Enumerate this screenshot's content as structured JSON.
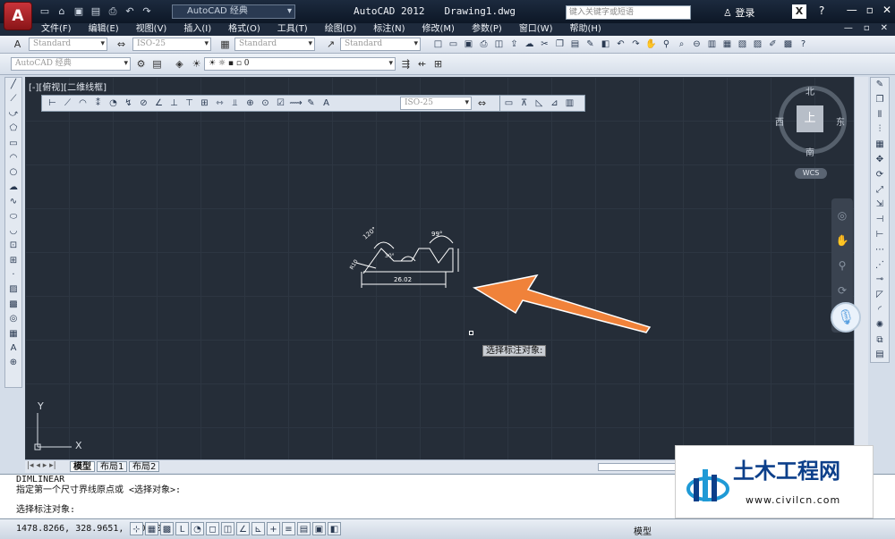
{
  "title": {
    "app": "AutoCAD 2012",
    "file": "Drawing1.dwg",
    "app_letter": "A"
  },
  "workspace": "AutoCAD 经典",
  "search": {
    "placeholder": "键入关键字或短语"
  },
  "login_label": "登录",
  "menu": [
    "文件(F)",
    "编辑(E)",
    "视图(V)",
    "插入(I)",
    "格式(O)",
    "工具(T)",
    "绘图(D)",
    "标注(N)",
    "修改(M)",
    "参数(P)",
    "窗口(W)",
    "帮助(H)"
  ],
  "styles": {
    "text_style": "Standard",
    "dim_style": "ISO-25",
    "table_style": "Standard",
    "multileader_style": "Standard"
  },
  "layer": {
    "workspace2": "AutoCAD 经典",
    "current": "0"
  },
  "viewport_label": "[-][俯视][二维线框]",
  "dim_toolbar_style": "ISO-25",
  "viewcube": {
    "top": "上",
    "north": "北",
    "south": "南",
    "east": "东",
    "west": "西",
    "wcs": "WCS"
  },
  "drawing": {
    "dim_horizontal": "26.02",
    "dim_top_angle": "99°",
    "dim_left_angle": "120°",
    "dim_small_angle": "30°",
    "dim_radius": "R10"
  },
  "ucs": {
    "x": "X",
    "y": "Y"
  },
  "tooltip": "选择标注对象:",
  "tabs": [
    "模型",
    "布局1",
    "布局2"
  ],
  "command": {
    "line1": "DIMLINEAR",
    "line2": "指定第一个尺寸界线原点或 <选择对象>:",
    "input": "选择标注对象:"
  },
  "status": {
    "coords": "1478.8266, 328.9651, 0.0000",
    "model": "模型"
  },
  "watermark": {
    "title": "土木工程网",
    "url": "www.civilcn.com"
  },
  "colors": {
    "canvas": "#252d38",
    "arrow": "#f0823a",
    "titlebar": "#0d1726"
  }
}
